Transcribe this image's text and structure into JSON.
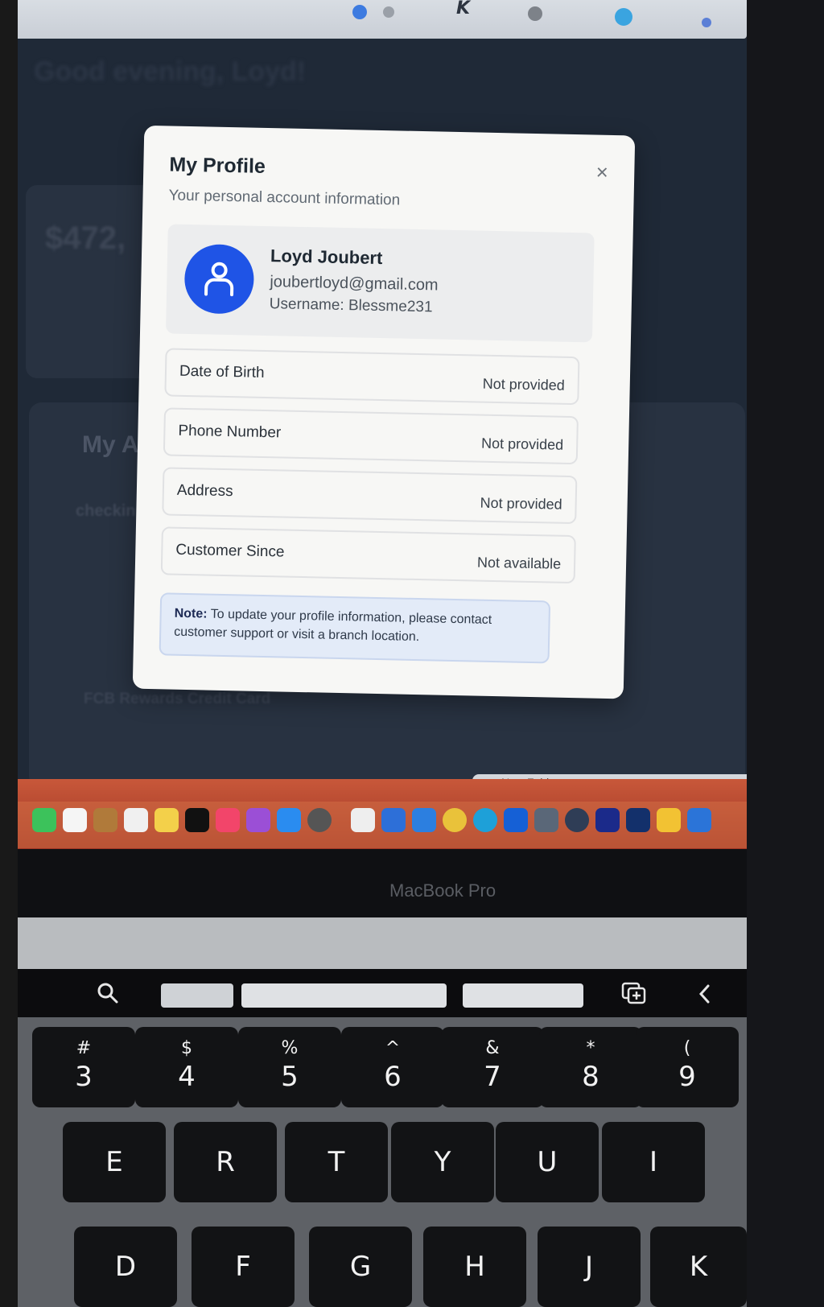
{
  "background": {
    "greeting": "Good evening, Loyd!",
    "balance": "$472,",
    "accounts_title": "My A",
    "checking_label": "checkin",
    "credit_card": "FCB Rewards Credit Card",
    "finder_tab": "New Folder",
    "bezel_label": "MacBook Pro"
  },
  "modal": {
    "title": "My Profile",
    "subtitle": "Your personal account information",
    "close_glyph": "×",
    "user": {
      "name": "Loyd Joubert",
      "email": "joubertloyd@gmail.com",
      "username": "Username: Blessme231"
    },
    "fields": [
      {
        "label": "Date of Birth",
        "value": "Not provided"
      },
      {
        "label": "Phone Number",
        "value": "Not provided"
      },
      {
        "label": "Address",
        "value": "Not provided"
      },
      {
        "label": "Customer Since",
        "value": "Not available"
      }
    ],
    "note_prefix": "Note:",
    "note_text": "To update your profile information, please contact customer support or visit a branch location."
  },
  "keyboard": {
    "number_row": [
      {
        "top": "#",
        "main": "3"
      },
      {
        "top": "$",
        "main": "4"
      },
      {
        "top": "%",
        "main": "5"
      },
      {
        "top": "^",
        "main": "6"
      },
      {
        "top": "&",
        "main": "7"
      },
      {
        "top": "*",
        "main": "8"
      },
      {
        "top": "(",
        "main": "9"
      }
    ],
    "letter_row_1": [
      "E",
      "R",
      "T",
      "Y",
      "U",
      "I"
    ],
    "letter_row_2": [
      "D",
      "F",
      "G",
      "H",
      "J",
      "K"
    ]
  },
  "colors": {
    "avatar": "#1f54e6",
    "modal_bg": "#f7f7f5",
    "note_bg": "#e3ebf8"
  },
  "icons": [
    "user-icon",
    "close-icon",
    "search-icon",
    "duplicate-icon",
    "chevron-left-icon"
  ]
}
